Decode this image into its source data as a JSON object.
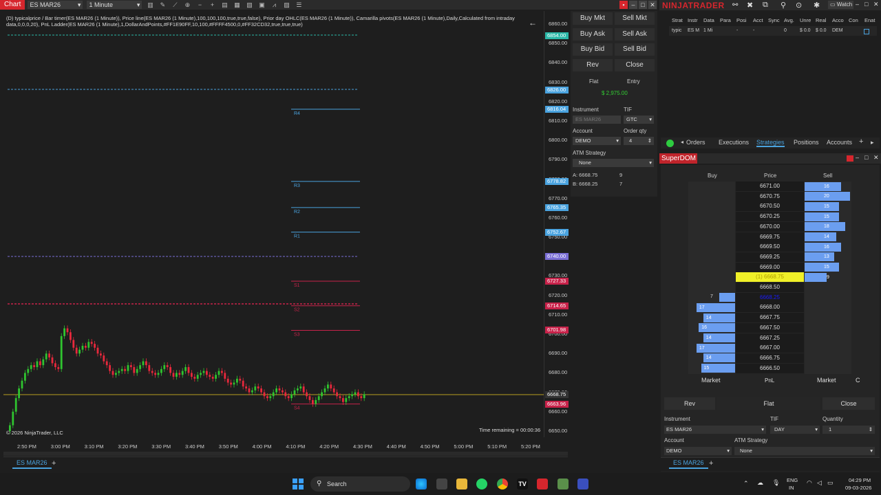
{
  "topbar": {
    "chart_tab": "Chart",
    "instrument": "ES MAR26",
    "interval": "1 Minute"
  },
  "chart": {
    "info_text": "(D) typicalprice / Bar timer(ES MAR26 (1 Minute)), Price line(ES MAR26 (1 Minute),100,100,100,true,true,false), Prior day OHLC(ES MAR26 (1 Minute)), Camarilla pivots(ES MAR26 (1 Minute),Daily,Calculated from intraday data,0,0,0,20), PnL Ladder(ES MAR26 (1 Minute),1,DollarAndPoints,#FF1E90FF,10,100,#FFFF4500,0,#FF32CD32,true,true,true)",
    "copyright": "© 2026 NinjaTrader, LLC",
    "time_remaining": "Time remaining = 00:00:36",
    "pivot_labels": [
      "R4",
      "R3",
      "R2",
      "R1",
      "S1",
      "S2",
      "S3",
      "S4"
    ],
    "price_ticks": [
      "6860.00",
      "6850.00",
      "6840.00",
      "6830.00",
      "6820.00",
      "6810.00",
      "6800.00",
      "6790.00",
      "6780.00",
      "6770.00",
      "6760.00",
      "6750.00",
      "6740.00",
      "6730.00",
      "6720.00",
      "6710.00",
      "6700.00",
      "6690.00",
      "6680.00",
      "6670.00",
      "6660.00",
      "6650.00"
    ],
    "price_markers": [
      {
        "value": "6854.00",
        "color": "#2bb8a8"
      },
      {
        "value": "6826.00",
        "color": "#4aa3df"
      },
      {
        "value": "6816.04",
        "color": "#4aa3df"
      },
      {
        "value": "6778.82",
        "color": "#4aa3df"
      },
      {
        "value": "6765.35",
        "color": "#4aa3df"
      },
      {
        "value": "6752.67",
        "color": "#4aa3df"
      },
      {
        "value": "6740.00",
        "color": "#7b6fd6"
      },
      {
        "value": "6727.33",
        "color": "#c8224a"
      },
      {
        "value": "6714.65",
        "color": "#c8224a"
      },
      {
        "value": "6701.98",
        "color": "#c8224a"
      },
      {
        "value": "6668.75",
        "color": "#333333"
      },
      {
        "value": "6663.96",
        "color": "#c8224a"
      }
    ],
    "time_ticks": [
      "2:50 PM",
      "3:00 PM",
      "3:10 PM",
      "3:20 PM",
      "3:30 PM",
      "3:40 PM",
      "3:50 PM",
      "4:00 PM",
      "4:10 PM",
      "4:20 PM",
      "4:30 PM",
      "4:40 PM",
      "4:50 PM",
      "5:00 PM",
      "5:10 PM",
      "5:20 PM"
    ],
    "tab": "ES MAR26"
  },
  "order_panel": {
    "buy_mkt": "Buy Mkt",
    "sell_mkt": "Sell Mkt",
    "buy_ask": "Buy Ask",
    "sell_ask": "Sell Ask",
    "buy_bid": "Buy Bid",
    "sell_bid": "Sell Bid",
    "rev": "Rev",
    "close": "Close",
    "flat": "Flat",
    "entry": "Entry",
    "pnl": "$ 2,975.00",
    "instrument_label": "Instrument",
    "tif_label": "TIF",
    "instrument_value": "ES MAR26",
    "tif_value": "GTC",
    "account_label": "Account",
    "order_qty_label": "Order qty",
    "account_value": "DEMO",
    "order_qty_value": "4",
    "atm_label": "ATM Strategy",
    "atm_value": "None",
    "ask_line": "A: 6668.75",
    "ask_size": "9",
    "bid_line": "B: 6668.25",
    "bid_size": "7"
  },
  "control_center": {
    "logo": "NINJATRADER",
    "watch": "Watch",
    "columns": [
      "Strat",
      "Instr",
      "Data",
      "Para",
      "Posi",
      "Acct",
      "Sync",
      "Avg.",
      "Unre",
      "Real",
      "Acco",
      "Con",
      "Enat"
    ],
    "row": [
      "typic",
      "ES M",
      "1 Mi",
      "",
      "-",
      "-",
      "",
      "0",
      "$ 0.0",
      "$ 0.0",
      "DEM",
      "",
      ""
    ],
    "tabs": [
      "Orders",
      "Executions",
      "Strategies",
      "Positions",
      "Accounts"
    ]
  },
  "superdom": {
    "title": "SuperDOM",
    "buy_header": "Buy",
    "price_header": "Price",
    "sell_header": "Sell",
    "rows": [
      {
        "price": "6671.00",
        "sell": "16"
      },
      {
        "price": "6670.75",
        "sell": "20"
      },
      {
        "price": "6670.50",
        "sell": "15"
      },
      {
        "price": "6670.25",
        "sell": "15"
      },
      {
        "price": "6670.00",
        "sell": "18"
      },
      {
        "price": "6669.75",
        "sell": "14"
      },
      {
        "price": "6669.50",
        "sell": "16"
      },
      {
        "price": "6669.25",
        "sell": "13"
      },
      {
        "price": "6669.00",
        "sell": "15"
      },
      {
        "price": "(1) 6668.75",
        "sell": "9",
        "highlight": true
      },
      {
        "price": "6668.50"
      },
      {
        "price": "6668.25",
        "buy": "7",
        "bid": true
      },
      {
        "price": "6668.00",
        "buy": "17"
      },
      {
        "price": "6667.75",
        "buy": "14"
      },
      {
        "price": "6667.50",
        "buy": "16"
      },
      {
        "price": "6667.25",
        "buy": "14"
      },
      {
        "price": "6667.00",
        "buy": "17"
      },
      {
        "price": "6666.75",
        "buy": "14"
      },
      {
        "price": "6666.50",
        "buy": "15"
      }
    ],
    "market_left": "Market",
    "pnl": "PnL",
    "market_right": "Market",
    "c": "C",
    "rev": "Rev",
    "flat": "Flat",
    "close": "Close",
    "instrument_label": "Instrument",
    "tif_label": "TIF",
    "quantity_label": "Quantity",
    "instrument_value": "ES MAR26",
    "tif_value": "DAY",
    "quantity_value": "1",
    "account_label": "Account",
    "atm_label": "ATM Strategy",
    "account_value": "DEMO",
    "atm_value": "None",
    "tab": "ES MAR26"
  },
  "taskbar": {
    "search": "Search",
    "lang": "ENG",
    "region": "IN",
    "time": "04:29 PM",
    "date": "09-03-2026"
  }
}
